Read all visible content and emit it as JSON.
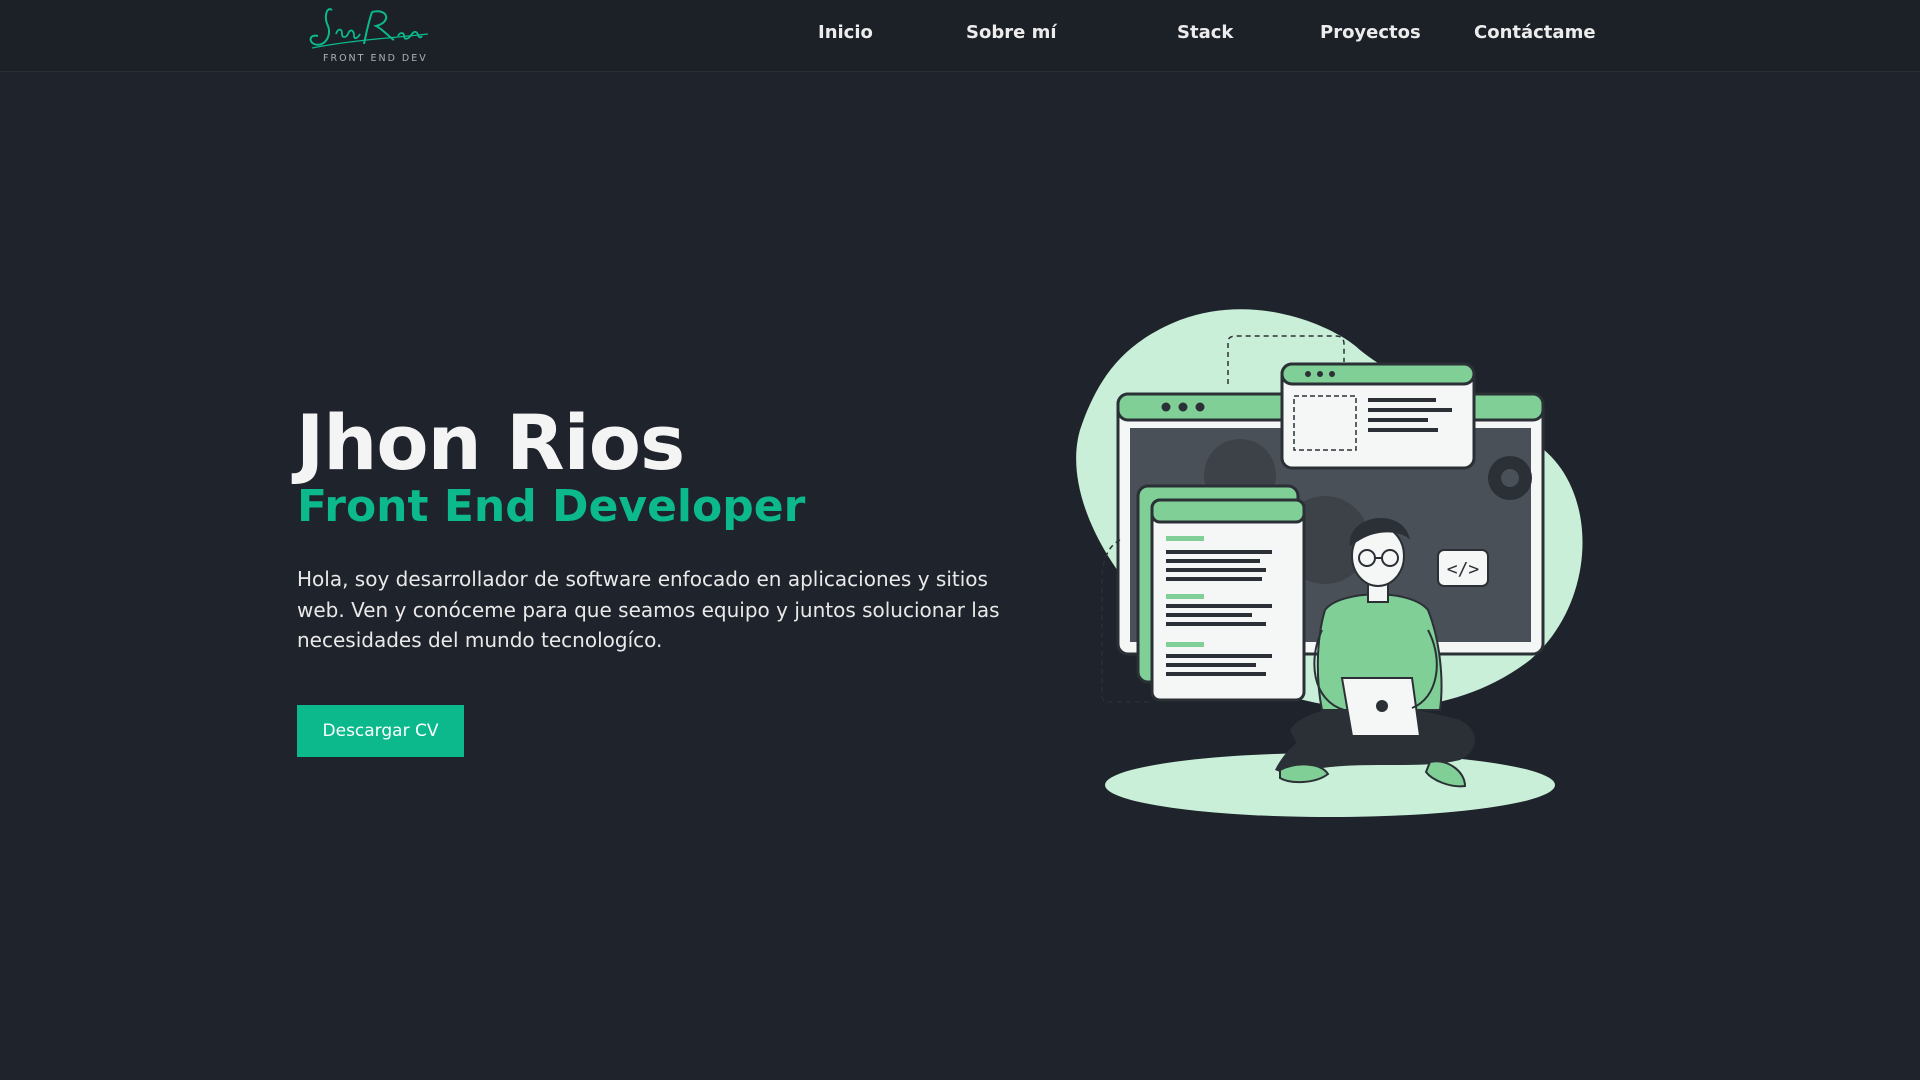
{
  "nav": {
    "logo": {
      "script": "Jhon Rios",
      "subtitle": "FRONT END DEV"
    },
    "items": [
      {
        "label": "Inicio"
      },
      {
        "label": "Sobre mí"
      },
      {
        "label": "Stack"
      },
      {
        "label": "Proyectos"
      },
      {
        "label": "Contáctame"
      }
    ]
  },
  "hero": {
    "name": "Jhon Rios",
    "role": "Front End Developer",
    "description": "Hola, soy desarrollador de software enfocado en aplicaciones y sitios web. Ven y conóceme para que seamos equipo y juntos solucionar las necesidades del mundo tecnologíco.",
    "cta_label": "Descargar CV",
    "illustration": {
      "code_tag": "</>"
    }
  },
  "colors": {
    "background": "#1f242c",
    "accent": "#0bb98c",
    "illustration_light": "#c9efd8",
    "illustration_mid": "#7fcf97"
  }
}
